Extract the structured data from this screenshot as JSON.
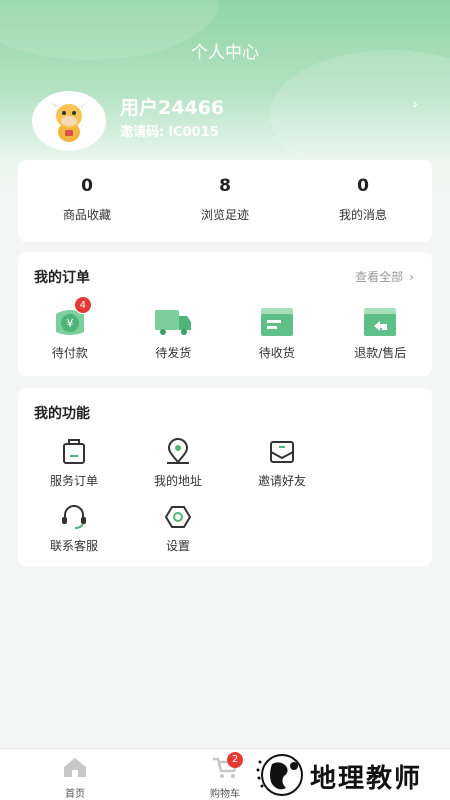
{
  "header": {
    "title": "个人中心"
  },
  "profile": {
    "username": "用户24466",
    "invite_label": "邀请码:",
    "invite_code": "IC0015"
  },
  "stats": [
    {
      "value": "0",
      "label": "商品收藏"
    },
    {
      "value": "8",
      "label": "浏览足迹"
    },
    {
      "value": "0",
      "label": "我的消息"
    }
  ],
  "orders": {
    "title": "我的订单",
    "see_all": "查看全部",
    "items": [
      {
        "label": "待付款",
        "badge": "4",
        "icon": "wallet-icon"
      },
      {
        "label": "待发货",
        "icon": "truck-icon"
      },
      {
        "label": "待收货",
        "icon": "package-icon"
      },
      {
        "label": "退款/售后",
        "icon": "refund-icon"
      }
    ]
  },
  "functions": {
    "title": "我的功能",
    "items": [
      {
        "label": "服务订单",
        "icon": "service-order-icon"
      },
      {
        "label": "我的地址",
        "icon": "location-icon"
      },
      {
        "label": "邀请好友",
        "icon": "invite-mail-icon"
      },
      {
        "label": "联系客服",
        "icon": "headset-icon"
      },
      {
        "label": "设置",
        "icon": "settings-icon"
      }
    ]
  },
  "tabbar": {
    "home": {
      "label": "首页",
      "icon": "home-icon"
    },
    "cart": {
      "label": "购物车",
      "badge": "2",
      "icon": "cart-icon"
    }
  },
  "watermark": {
    "text": "地理教师"
  },
  "colors": {
    "accent": "#5fbf88",
    "badge": "#e53935",
    "header_gradient_top": "#8fd4a6"
  }
}
